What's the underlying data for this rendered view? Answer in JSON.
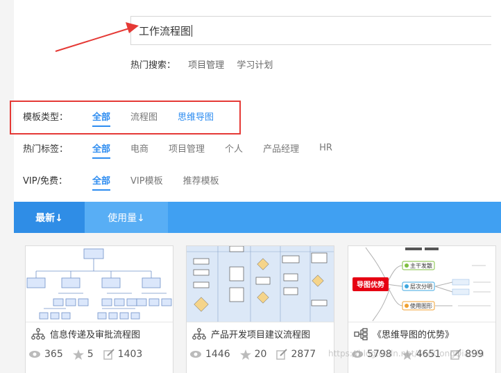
{
  "search": {
    "value": "工作流程图",
    "hot_label": "热门搜索：",
    "hot_keywords": [
      "项目管理",
      "学习计划"
    ]
  },
  "filters": {
    "template_type": {
      "label": "模板类型：",
      "options": [
        "全部",
        "流程图",
        "思维导图"
      ]
    },
    "hot_tags": {
      "label": "热门标签：",
      "options": [
        "全部",
        "电商",
        "项目管理",
        "个人",
        "产品经理",
        "HR"
      ]
    },
    "vip": {
      "label": "VIP/免费：",
      "options": [
        "全部",
        "VIP模板",
        "推荐模板"
      ]
    }
  },
  "sort": {
    "newest": "最新↓",
    "usage": "使用量↓"
  },
  "cards": [
    {
      "title": "信息传递及审批流程图",
      "icon": "org-chart-icon",
      "views": "365",
      "stars": "5",
      "edits": "1403"
    },
    {
      "title": "产品开发项目建议流程图",
      "icon": "org-chart-icon",
      "views": "1446",
      "stars": "20",
      "edits": "2877"
    },
    {
      "title": "《思维导图的优势》",
      "icon": "mindmap-icon",
      "views": "5798",
      "stars": "4651",
      "edits": "899"
    }
  ],
  "mindmap_preview": {
    "center": "导图优势",
    "branches": [
      "主干发散",
      "层次分明",
      "使用图形"
    ]
  },
  "watermark": "https://blog.csdn.net/SanGongQiao.lu",
  "colors": {
    "accent": "#2d8cf0",
    "sort_bar": "#40a0f2",
    "highlight": "#e53935"
  }
}
